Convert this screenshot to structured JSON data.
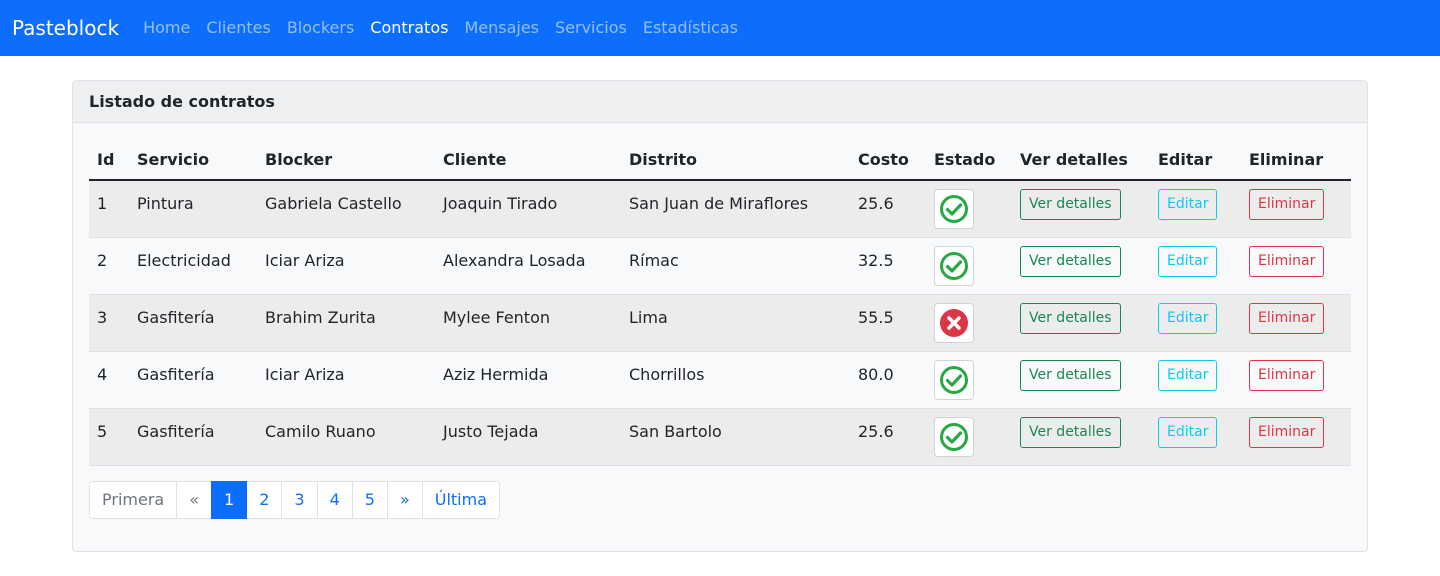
{
  "navbar": {
    "brand": "Pasteblock",
    "links": [
      {
        "label": "Home",
        "active": false
      },
      {
        "label": "Clientes",
        "active": false
      },
      {
        "label": "Blockers",
        "active": false
      },
      {
        "label": "Contratos",
        "active": true
      },
      {
        "label": "Mensajes",
        "active": false
      },
      {
        "label": "Servicios",
        "active": false
      },
      {
        "label": "Estadísticas",
        "active": false
      }
    ]
  },
  "card": {
    "title": "Listado de contratos"
  },
  "table": {
    "headers": [
      "Id",
      "Servicio",
      "Blocker",
      "Cliente",
      "Distrito",
      "Costo",
      "Estado",
      "Ver detalles",
      "Editar",
      "Eliminar"
    ],
    "rows": [
      {
        "id": "1",
        "servicio": "Pintura",
        "blocker": "Gabriela Castello",
        "cliente": "Joaquin Tirado",
        "distrito": "San Juan de Miraflores",
        "costo": "25.6",
        "estado": "check-icon",
        "ver": "Ver detalles",
        "editar": "Editar",
        "eliminar": "Eliminar"
      },
      {
        "id": "2",
        "servicio": "Electricidad",
        "blocker": "Iciar Ariza",
        "cliente": "Alexandra Losada",
        "distrito": "Rímac",
        "costo": "32.5",
        "estado": "check-icon",
        "ver": "Ver detalles",
        "editar": "Editar",
        "eliminar": "Eliminar"
      },
      {
        "id": "3",
        "servicio": "Gasfitería",
        "blocker": "Brahim Zurita",
        "cliente": "Mylee Fenton",
        "distrito": "Lima",
        "costo": "55.5",
        "estado": "x-icon",
        "ver": "Ver detalles",
        "editar": "Editar",
        "eliminar": "Eliminar"
      },
      {
        "id": "4",
        "servicio": "Gasfitería",
        "blocker": "Iciar Ariza",
        "cliente": "Aziz Hermida",
        "distrito": "Chorrillos",
        "costo": "80.0",
        "estado": "check-icon",
        "ver": "Ver detalles",
        "editar": "Editar",
        "eliminar": "Eliminar"
      },
      {
        "id": "5",
        "servicio": "Gasfitería",
        "blocker": "Camilo Ruano",
        "cliente": "Justo Tejada",
        "distrito": "San Bartolo",
        "costo": "25.6",
        "estado": "check-icon",
        "ver": "Ver detalles",
        "editar": "Editar",
        "eliminar": "Eliminar"
      }
    ]
  },
  "pagination": {
    "items": [
      {
        "label": "Primera",
        "state": "disabled"
      },
      {
        "label": "«",
        "state": "disabled"
      },
      {
        "label": "1",
        "state": "active"
      },
      {
        "label": "2",
        "state": "normal"
      },
      {
        "label": "3",
        "state": "normal"
      },
      {
        "label": "4",
        "state": "normal"
      },
      {
        "label": "5",
        "state": "normal"
      },
      {
        "label": "»",
        "state": "normal"
      },
      {
        "label": "Última",
        "state": "normal"
      }
    ]
  },
  "colors": {
    "primary": "#0d6efd",
    "success": "#198754",
    "info": "#0dcaf0",
    "danger": "#dc3545",
    "status_ok": "#28a745",
    "status_error": "#dc3545"
  }
}
